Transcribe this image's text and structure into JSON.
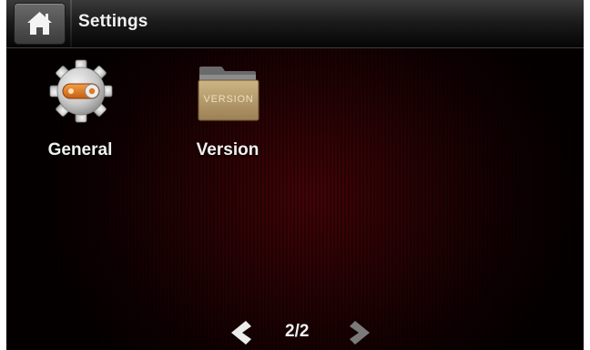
{
  "header": {
    "title": "Settings",
    "home_icon": "home-icon"
  },
  "tiles": [
    {
      "label": "General",
      "icon": "gear-toggle-icon"
    },
    {
      "label": "Version",
      "icon": "version-folder-icon",
      "icon_text": "VERSION"
    }
  ],
  "pager": {
    "indicator": "2/2",
    "prev_icon": "chevron-left-icon",
    "next_icon": "chevron-right-icon"
  },
  "colors": {
    "background": "#050000",
    "background_glow": "#460406",
    "text": "#f0f0f0",
    "toggle_accent": "#e07a1c",
    "folder_body": "#b79c6a"
  }
}
